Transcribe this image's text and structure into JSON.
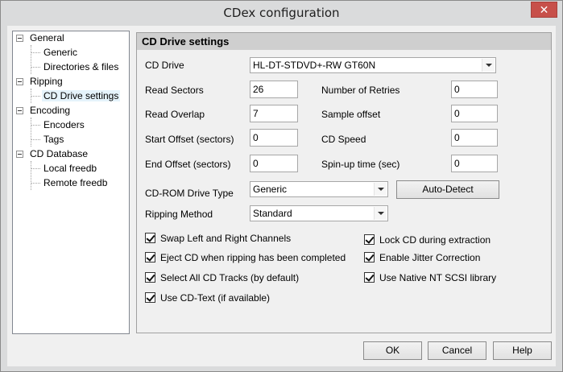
{
  "window": {
    "title": "CDex configuration",
    "close_glyph": "✕"
  },
  "tree": {
    "nodes": [
      {
        "label": "General",
        "expanded": true
      },
      {
        "label": "Generic"
      },
      {
        "label": "Directories & files"
      },
      {
        "label": "Ripping",
        "expanded": true
      },
      {
        "label": "CD Drive settings",
        "selected": true
      },
      {
        "label": "Encoding",
        "expanded": true
      },
      {
        "label": "Encoders"
      },
      {
        "label": "Tags"
      },
      {
        "label": "CD Database",
        "expanded": true
      },
      {
        "label": "Local freedb"
      },
      {
        "label": "Remote freedb"
      }
    ]
  },
  "panel": {
    "header": "CD Drive settings",
    "cd_drive": {
      "label": "CD Drive",
      "value": "HL-DT-STDVD+-RW GT60N"
    },
    "read_sectors": {
      "label": "Read Sectors",
      "value": "26"
    },
    "read_overlap": {
      "label": "Read Overlap",
      "value": "7"
    },
    "start_offset": {
      "label": "Start Offset (sectors)",
      "value": "0"
    },
    "end_offset": {
      "label": "End Offset (sectors)",
      "value": "0"
    },
    "number_of_retries": {
      "label": "Number of Retries",
      "value": "0"
    },
    "sample_offset": {
      "label": "Sample offset",
      "value": "0"
    },
    "cd_speed": {
      "label": "CD Speed",
      "value": "0"
    },
    "spin_up_time": {
      "label": "Spin-up time (sec)",
      "value": "0"
    },
    "drive_type": {
      "label": "CD-ROM Drive Type",
      "value": "Generic"
    },
    "ripping_method": {
      "label": "Ripping Method",
      "value": "Standard"
    },
    "auto_detect_label": "Auto-Detect",
    "checkboxes": [
      {
        "label": "Swap Left and Right Channels",
        "checked": true
      },
      {
        "label": "Eject CD when ripping has been completed",
        "checked": true
      },
      {
        "label": "Select All CD Tracks (by default)",
        "checked": true
      },
      {
        "label": "Use CD-Text (if available)",
        "checked": true
      },
      {
        "label": "Lock CD during extraction",
        "checked": true
      },
      {
        "label": "Enable Jitter Correction",
        "checked": true
      },
      {
        "label": "Use Native NT SCSI library",
        "checked": true
      }
    ]
  },
  "footer": {
    "ok_label": "OK",
    "cancel_label": "Cancel",
    "help_label": "Help"
  }
}
